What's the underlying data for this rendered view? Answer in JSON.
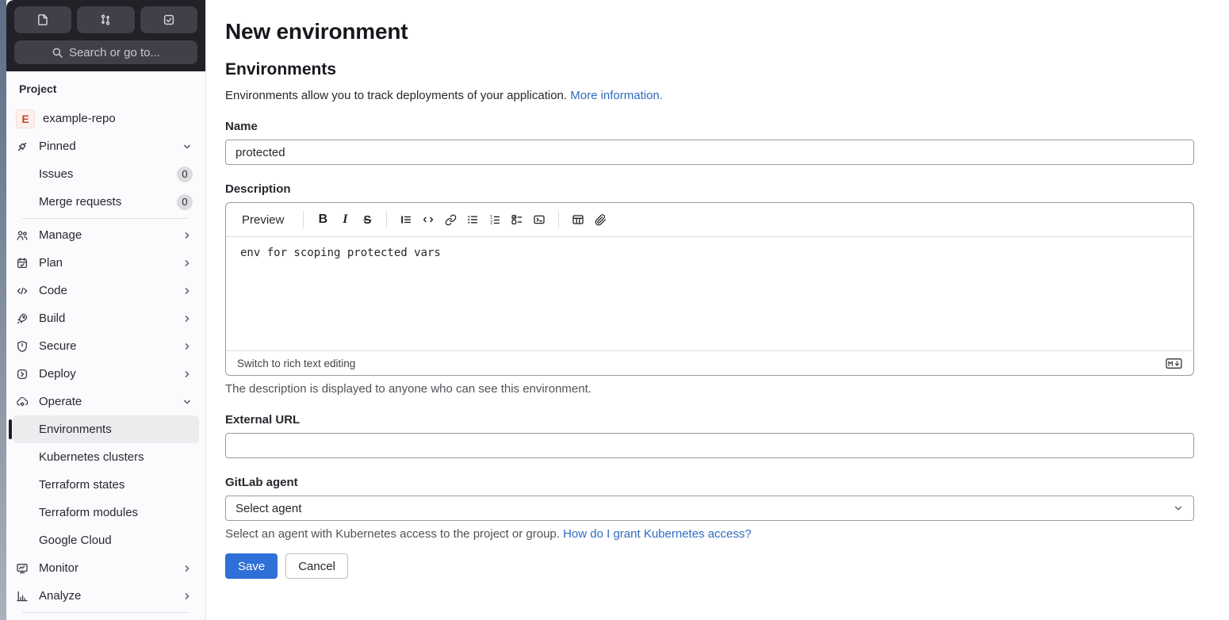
{
  "topbar": {
    "search_label": "Search or go to...",
    "icons": [
      "issues-document-icon",
      "merge-request-icon",
      "todo-done-icon",
      "search-icon"
    ]
  },
  "sidebar": {
    "section_label": "Project",
    "project": {
      "avatar_letter": "E",
      "name": "example-repo"
    },
    "items": [
      {
        "label": "Pinned",
        "icon": "pin-icon",
        "chevron": "down"
      },
      {
        "label": "Issues",
        "badge": "0"
      },
      {
        "label": "Merge requests",
        "badge": "0"
      },
      {
        "label": "Manage",
        "icon": "users-icon",
        "chevron": "right"
      },
      {
        "label": "Plan",
        "icon": "calendar-icon",
        "chevron": "right"
      },
      {
        "label": "Code",
        "icon": "code-icon",
        "chevron": "right"
      },
      {
        "label": "Build",
        "icon": "rocket-icon",
        "chevron": "right"
      },
      {
        "label": "Secure",
        "icon": "shield-icon",
        "chevron": "right"
      },
      {
        "label": "Deploy",
        "icon": "deploy-icon",
        "chevron": "right"
      },
      {
        "label": "Operate",
        "icon": "cloud-gear-icon",
        "chevron": "down"
      },
      {
        "label": "Environments",
        "selected": true
      },
      {
        "label": "Kubernetes clusters"
      },
      {
        "label": "Terraform states"
      },
      {
        "label": "Terraform modules"
      },
      {
        "label": "Google Cloud"
      },
      {
        "label": "Monitor",
        "icon": "monitor-icon",
        "chevron": "right"
      },
      {
        "label": "Analyze",
        "icon": "chart-icon",
        "chevron": "right"
      }
    ]
  },
  "main": {
    "title": "New environment",
    "section_title": "Environments",
    "intro_text": "Environments allow you to track deployments of your application.",
    "intro_link": "More information.",
    "name_label": "Name",
    "name_value": "protected",
    "description_label": "Description",
    "toolbar": {
      "preview_label": "Preview",
      "icons": [
        "bold-icon",
        "italic-icon",
        "strikethrough-icon",
        "quote-icon",
        "code-icon",
        "link-icon",
        "bulleted-list-icon",
        "numbered-list-icon",
        "task-list-icon",
        "collapsible-section-icon",
        "table-icon",
        "attach-file-icon"
      ]
    },
    "description_value": "env for scoping protected vars",
    "editor_footer_action": "Switch to rich text editing",
    "markdown_icon": "markdown-icon",
    "description_help": "The description is displayed to anyone who can see this environment.",
    "external_url_label": "External URL",
    "external_url_value": "",
    "agent_label": "GitLab agent",
    "agent_value": "Select agent",
    "agent_help": "Select an agent with Kubernetes access to the project or group.",
    "agent_help_link": "How do I grant Kubernetes access?",
    "save_label": "Save",
    "cancel_label": "Cancel"
  },
  "colors": {
    "accent_blue": "#2e6fd8",
    "link_blue": "#2f6bbf",
    "topbar_dark": "#222127",
    "sidebar_bg": "#fbfafd",
    "selected_bg": "#ececef"
  }
}
